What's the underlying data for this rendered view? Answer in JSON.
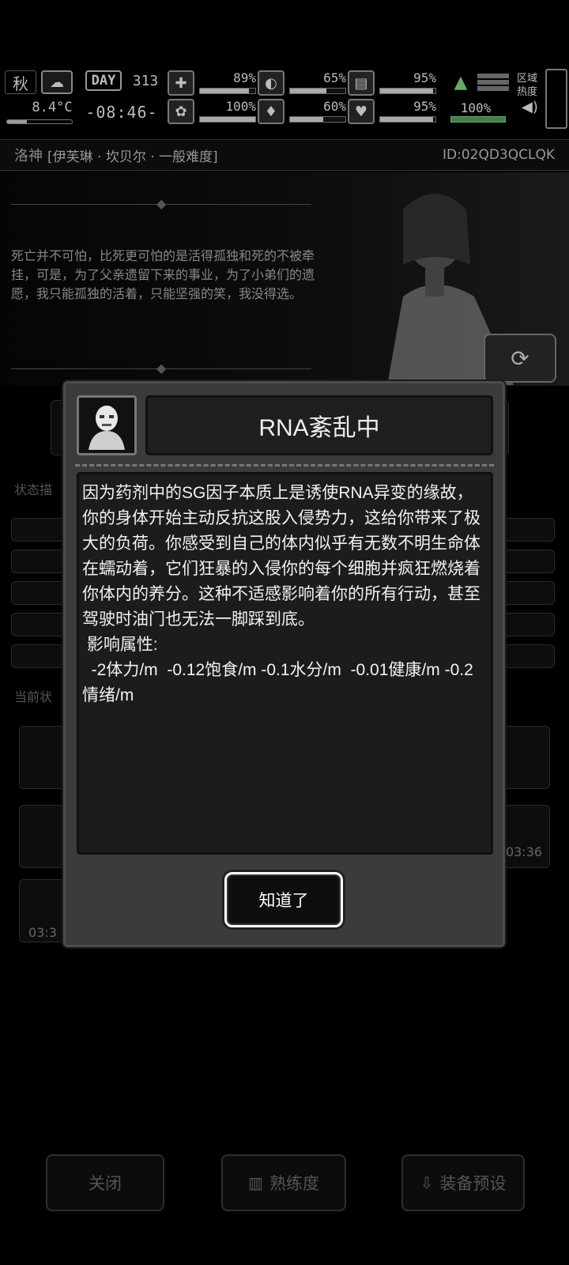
{
  "hud": {
    "season": "秋",
    "day_label": "DAY",
    "day_number": "313",
    "temperature": "8.4°C",
    "temperature_fill": 0.3,
    "clock": "-08:46-",
    "region_label": "区域热度",
    "stats": [
      {
        "name": "health",
        "icon": "medkit-icon",
        "glyph": "✚",
        "value": "89%",
        "fill": 0.89
      },
      {
        "name": "stomach",
        "icon": "stomach-icon",
        "glyph": "◐",
        "value": "65%",
        "fill": 0.65
      },
      {
        "name": "stamina",
        "icon": "lungs-icon",
        "glyph": "▤",
        "value": "95%",
        "fill": 0.95
      },
      {
        "name": "brain",
        "icon": "brain-icon",
        "glyph": "✿",
        "value": "100%",
        "fill": 1.0
      },
      {
        "name": "water",
        "icon": "water-drop-icon",
        "glyph": "💧",
        "value": "60%",
        "fill": 0.6
      },
      {
        "name": "heart",
        "icon": "heart-icon",
        "glyph": "♥",
        "value": "95%",
        "fill": 0.95
      }
    ],
    "radiation_value": "100%"
  },
  "character": {
    "logo": "洛神",
    "difficulty": "[伊芙琳 · 坎贝尔 · 一般难度]",
    "id": "ID:02QD3QCLQK",
    "quote": "死亡并不可怕，比死更可怕的是活得孤独和死的不被牵挂，可是，为了父亲遗留下来的事业，为了小弟们的遗愿，我只能孤独的活着，只能坚强的笑，我没得选。"
  },
  "background": {
    "status_desc_label": "状态描",
    "current_status_label": "当前状",
    "timer_a": "03:36",
    "timer_b": "03:3"
  },
  "dialog": {
    "title": "RNA紊乱中",
    "body": "因为药剂中的SG因子本质上是诱使RNA异变的缘故，你的身体开始主动反抗这股入侵势力，这给你带来了极大的负荷。你感受到自己的体内似乎有无数不明生命体在蠕动着，它们狂暴的入侵你的每个细胞并疯狂燃烧着你体内的养分。这种不适感影响着你的所有行动，甚至驾驶时油门也无法一脚踩到底。\n 影响属性:\n  -2体力/m  -0.12饱食/m -0.1水分/m  -0.01健康/m -0.2情绪/m",
    "ok_label": "知道了"
  },
  "bottom": {
    "close_label": "关闭",
    "proficiency_label": "熟练度",
    "equip_preset_label": "装备预设"
  }
}
